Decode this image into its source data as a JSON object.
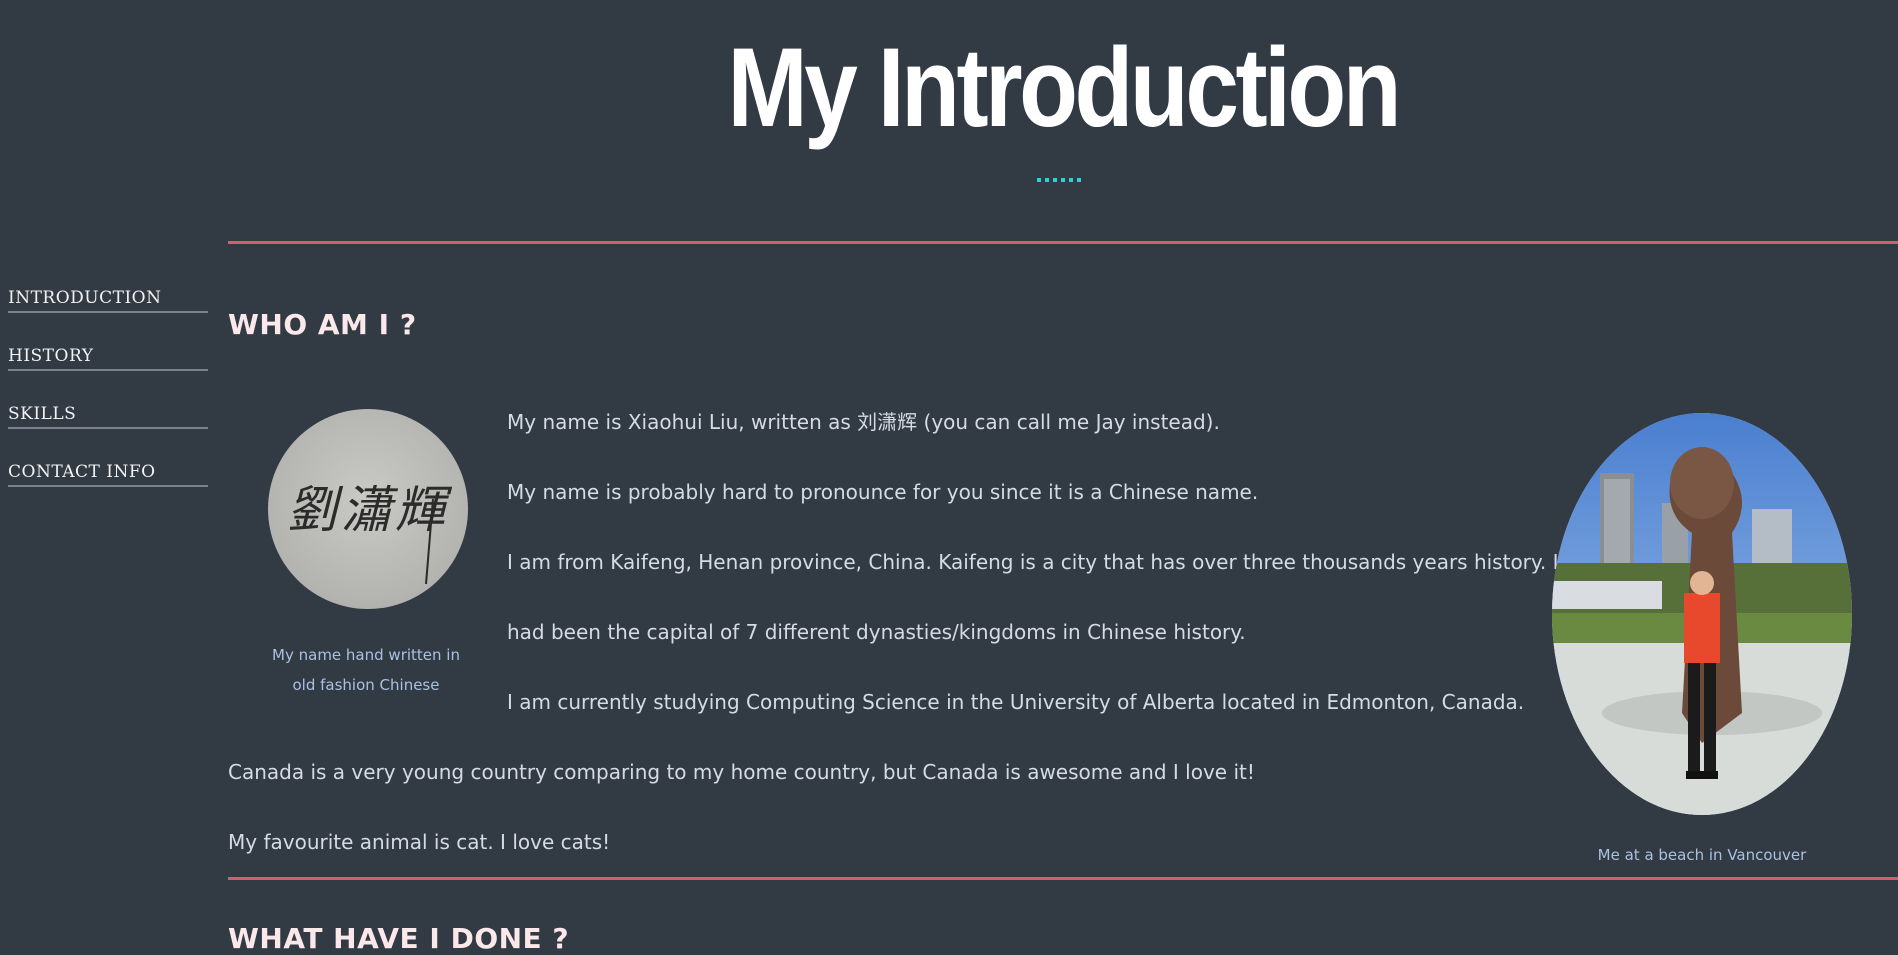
{
  "header": {
    "title": "My Introduction",
    "dots_color": "#2fd0d0"
  },
  "nav": {
    "items": [
      {
        "label": "INTRODUCTION"
      },
      {
        "label": "HISTORY"
      },
      {
        "label": "SKILLS"
      },
      {
        "label": "CONTACT INFO"
      }
    ]
  },
  "sections": {
    "who": {
      "heading": "WHO AM I ?",
      "signature_image": {
        "text": "劉瀟輝"
      },
      "signature_caption": [
        "My name hand written in",
        "old fashion Chinese"
      ],
      "paragraphs": [
        "My name is Xiaohui Liu, written as 刘潇辉 (you can call me Jay instead).",
        "My name is probably hard to pronounce for you since it is a Chinese name.",
        "I am from Kaifeng, Henan province, China. Kaifeng is a city that has over three thousands years history. It",
        "had been the capital of 7 different dynasties/kingdoms in Chinese history.",
        "I am currently studying Computing Science in the University of Alberta located in Edmonton, Canada.",
        "Canada is a very young country comparing to my home country, but Canada is awesome and I love it!",
        "My favourite animal is cat. I love cats!"
      ],
      "photo_caption": "Me at a beach in Vancouver"
    },
    "done": {
      "heading": "WHAT HAVE I DONE ?"
    }
  },
  "colors": {
    "background": "#323a44",
    "rule": "#d45d6e",
    "caption": "#a9c1e0",
    "heading": "#fbe8ea"
  }
}
